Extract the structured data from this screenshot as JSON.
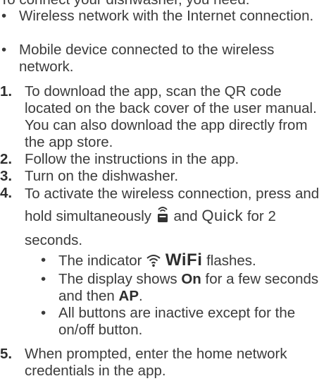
{
  "intro": "To connect your dishwasher, you need:",
  "requirements": [
    "Wireless network with the Internet connection.",
    "Mobile device connected to the wireless network."
  ],
  "steps": [
    {
      "number": "1.",
      "text": "To download the app, scan the QR code located on the back cover of the user manual. You can also download the app directly from the app store."
    },
    {
      "number": "2.",
      "text": "Follow the instructions in the app."
    },
    {
      "number": "3.",
      "text": "Turn on the dishwasher."
    },
    {
      "number": "4.",
      "text_before": "To activate the wireless connection, press and hold simultaneously",
      "icon_label": "remote-start-icon",
      "text_and": "and",
      "button_label": "Quick",
      "text_after": "for 2 seconds.",
      "substeps": [
        {
          "before": "The indicator",
          "icon": "wifi-icon",
          "word": "WiFi",
          "after": "flashes."
        },
        {
          "before": "The display shows",
          "bold1": "On",
          "middle": "for a few seconds and then",
          "bold2": "AP",
          "end": "."
        },
        {
          "text": "All buttons are inactive except for the on/off button."
        }
      ]
    },
    {
      "number": "5.",
      "text": "When prompted, enter the home network credentials in the app."
    }
  ],
  "bullet_glyph": "•"
}
